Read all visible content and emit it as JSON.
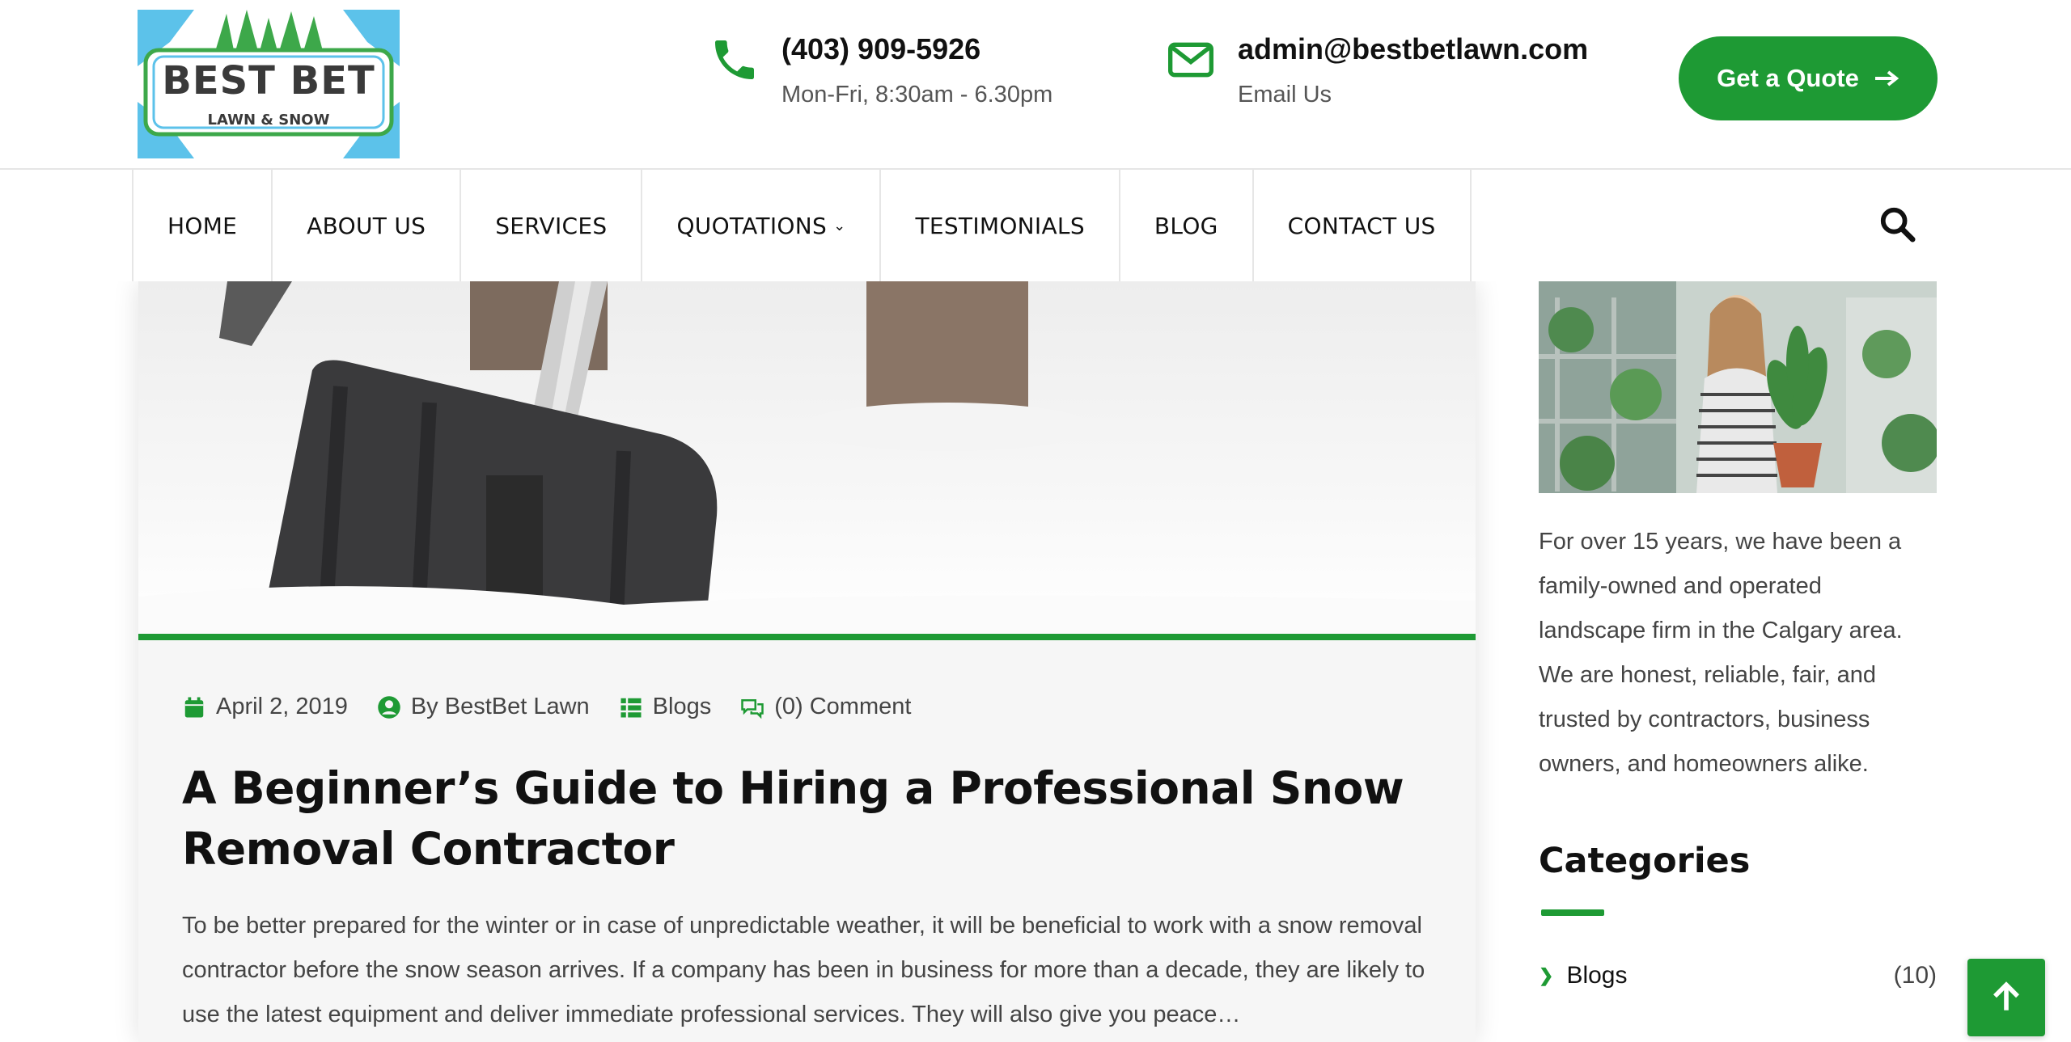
{
  "brand": {
    "logo_main": "BEST BET",
    "logo_sub": "LAWN & SNOW",
    "accent_color": "#1e9a34"
  },
  "header": {
    "phone": {
      "icon": "phone-icon",
      "number": "(403) 909-5926",
      "hours": "Mon-Fri, 8:30am - 6.30pm"
    },
    "email": {
      "icon": "envelope-icon",
      "address": "admin@bestbetlawn.com",
      "label": "Email Us"
    },
    "quote_button": "Get a Quote"
  },
  "nav": {
    "items": [
      {
        "label": "HOME"
      },
      {
        "label": "ABOUT US"
      },
      {
        "label": "SERVICES"
      },
      {
        "label": "QUOTATIONS",
        "has_dropdown": true
      },
      {
        "label": "TESTIMONIALS"
      },
      {
        "label": "BLOG"
      },
      {
        "label": "CONTACT US"
      }
    ],
    "search_icon": "search-icon"
  },
  "article": {
    "hero_alt": "snow shovel in snow",
    "meta": {
      "date": "April 2, 2019",
      "author": "By BestBet Lawn",
      "category": "Blogs",
      "comments": "(0) Comment"
    },
    "title": "A Beginner’s Guide to Hiring a Professional Snow Removal Contractor",
    "excerpt": "To be better prepared for the winter or in case of unpredictable weather, it will be beneficial to work with a snow removal contractor before the snow season arrives. If a company has been in business for more than a decade, they are likely to use the latest equipment and deliver immediate professional services. They will also give you peace…"
  },
  "sidebar": {
    "about_text": "For over 15 years, we have been a family-owned and operated landscape firm in the Calgary area. We are honest, reliable, fair, and trusted by contractors, business owners, and homeowners alike.",
    "categories_title": "Categories",
    "categories": [
      {
        "name": "Blogs",
        "count": "(10)"
      }
    ]
  },
  "back_to_top_icon": "arrow-up-icon"
}
